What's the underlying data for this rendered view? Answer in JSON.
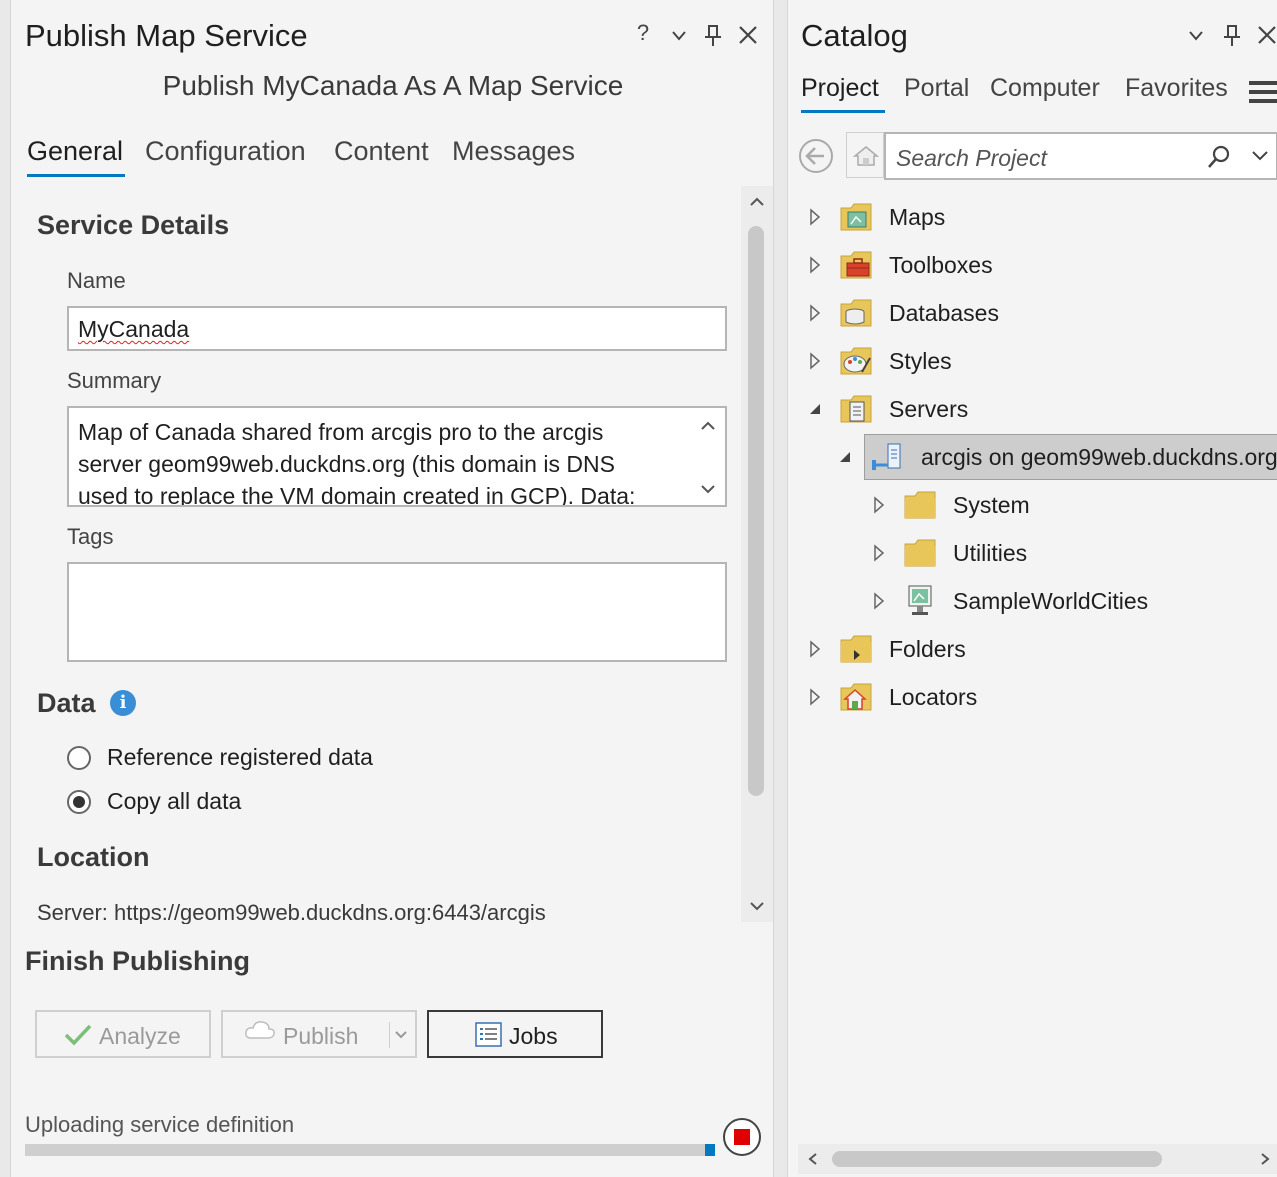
{
  "publish_pane": {
    "title": "Publish Map Service",
    "controls": {
      "help": "?",
      "menu": "⌄",
      "pin": "⊥",
      "close": "✕"
    },
    "subtitle": "Publish MyCanada As A Map Service",
    "tabs": [
      {
        "label": "General",
        "active": true
      },
      {
        "label": "Configuration",
        "active": false
      },
      {
        "label": "Content",
        "active": false
      },
      {
        "label": "Messages",
        "active": false
      }
    ],
    "service_details": {
      "heading": "Service Details",
      "name_label": "Name",
      "name_value": "MyCanada",
      "summary_label": "Summary",
      "summary_lines": [
        "Map of Canada shared from arcgis pro to the arcgis",
        "server geom99web.duckdns.org (this domain is DNS",
        "used to replace the VM domain created in GCP). Data:"
      ],
      "tags_label": "Tags",
      "tags_value": ""
    },
    "data_section": {
      "heading": "Data",
      "info_icon": "i",
      "options": [
        {
          "label": "Reference registered data",
          "selected": false
        },
        {
          "label": "Copy all data",
          "selected": true
        }
      ]
    },
    "location": {
      "heading": "Location",
      "server_text": "Server: https://geom99web.duckdns.org:6443/arcgis"
    },
    "finish": {
      "heading": "Finish Publishing",
      "analyze_label": "Analyze",
      "publish_label": "Publish",
      "jobs_label": "Jobs"
    },
    "status": {
      "text": "Uploading service definition",
      "progress": 0.99
    }
  },
  "catalog_pane": {
    "title": "Catalog",
    "controls": {
      "menu": "⌄",
      "pin": "⊥",
      "close": "✕"
    },
    "tabs": [
      {
        "label": "Project",
        "active": true
      },
      {
        "label": "Portal",
        "active": false
      },
      {
        "label": "Computer",
        "active": false
      },
      {
        "label": "Favorites",
        "active": false
      }
    ],
    "search_placeholder": "Search Project",
    "tree": [
      {
        "label": "Maps",
        "icon": "maps-folder-icon",
        "expanded": false,
        "level": 0
      },
      {
        "label": "Toolboxes",
        "icon": "toolboxes-folder-icon",
        "expanded": false,
        "level": 0
      },
      {
        "label": "Databases",
        "icon": "databases-folder-icon",
        "expanded": false,
        "level": 0
      },
      {
        "label": "Styles",
        "icon": "styles-folder-icon",
        "expanded": false,
        "level": 0
      },
      {
        "label": "Servers",
        "icon": "servers-folder-icon",
        "expanded": true,
        "level": 0
      },
      {
        "label": "arcgis on geom99web.duckdns.org",
        "icon": "server-connection-icon",
        "expanded": true,
        "level": 1,
        "selected": true
      },
      {
        "label": "System",
        "icon": "folder-icon",
        "expanded": false,
        "level": 2
      },
      {
        "label": "Utilities",
        "icon": "folder-icon",
        "expanded": false,
        "level": 2
      },
      {
        "label": "SampleWorldCities",
        "icon": "map-service-icon",
        "expanded": false,
        "level": 2
      },
      {
        "label": "Folders",
        "icon": "folders-folder-icon",
        "expanded": false,
        "level": 0
      },
      {
        "label": "Locators",
        "icon": "locators-folder-icon",
        "expanded": false,
        "level": 0
      }
    ]
  }
}
